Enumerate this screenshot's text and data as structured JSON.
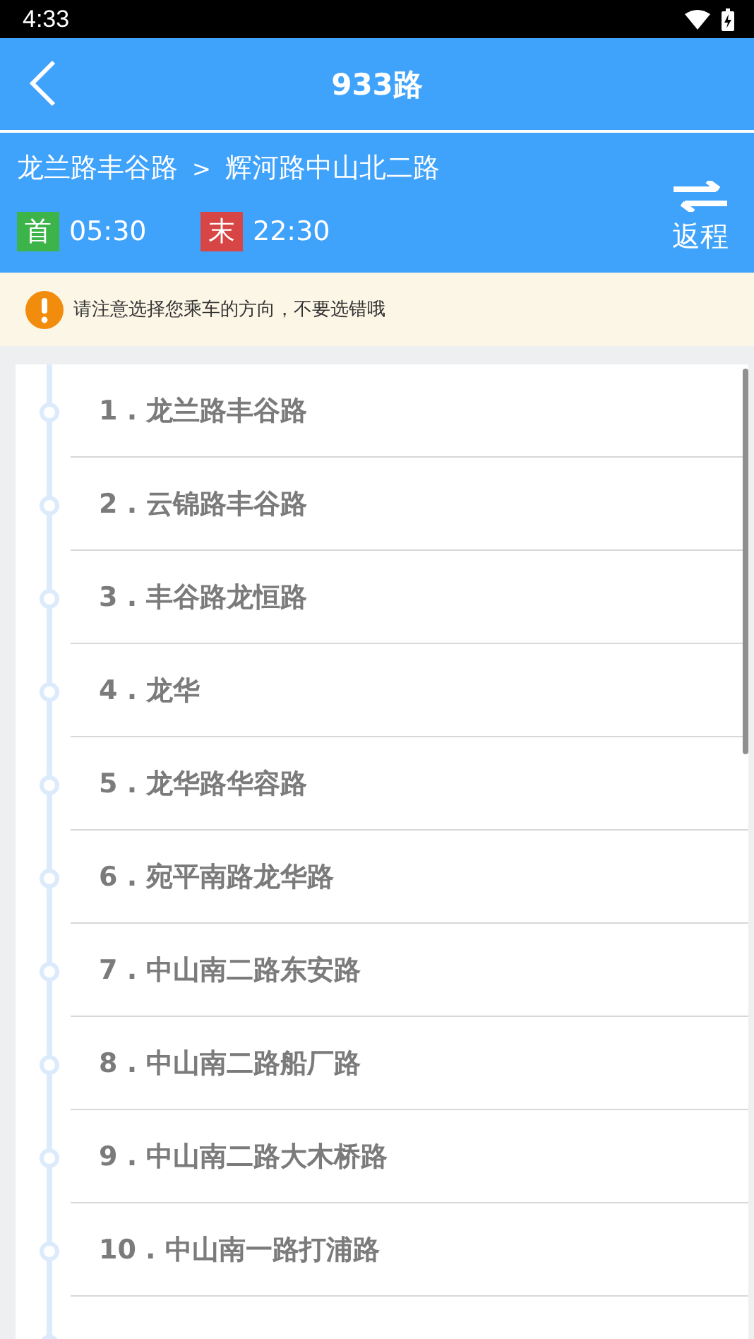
{
  "status_bar": {
    "time": "4:33"
  },
  "header": {
    "title": "933路"
  },
  "route": {
    "from": "龙兰路丰谷路",
    "separator": ">",
    "to": "辉河路中山北二路",
    "times": [
      {
        "badge": "首",
        "time": "05:30",
        "color": "#3cb44a"
      },
      {
        "badge": "末",
        "time": "22:30",
        "color": "#d84545"
      }
    ],
    "reverse_button": "返程"
  },
  "notice": {
    "text": "请注意选择您乘车的方向，不要选错哦"
  },
  "stops": [
    {
      "label": "1 . 龙兰路丰谷路"
    },
    {
      "label": "2 . 云锦路丰谷路"
    },
    {
      "label": "3 . 丰谷路龙恒路"
    },
    {
      "label": "4 . 龙华"
    },
    {
      "label": "5 . 龙华路华容路"
    },
    {
      "label": "6 . 宛平南路龙华路"
    },
    {
      "label": "7 . 中山南二路东安路"
    },
    {
      "label": "8 . 中山南二路船厂路"
    },
    {
      "label": "9 . 中山南二路大木桥路"
    },
    {
      "label": "10 . 中山南一路打浦路"
    }
  ]
}
